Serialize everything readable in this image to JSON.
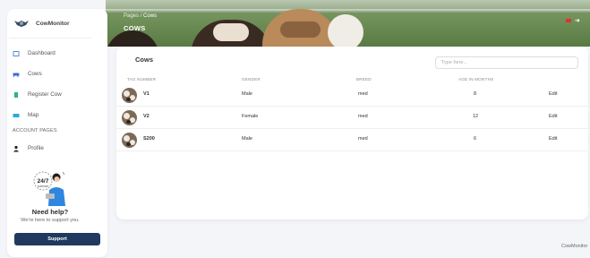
{
  "header": {
    "breadcrumb_root": "Pages",
    "breadcrumb_sep": "/",
    "breadcrumb_current": "Cows",
    "page_title": "COWS"
  },
  "sidebar": {
    "brand": "CowMonitor",
    "items": [
      {
        "label": "Dashboard",
        "icon": "dashboard-icon"
      },
      {
        "label": "Cows",
        "icon": "cow-icon"
      },
      {
        "label": "Register Cow",
        "icon": "register-icon"
      },
      {
        "label": "Map",
        "icon": "map-icon"
      }
    ],
    "section_label": "ACCOUNT PAGES",
    "profile_label": "Profile",
    "support": {
      "badge": "24/7",
      "badge_sub": "SUPPORT",
      "title": "Need help?",
      "subtitle": "We're here to support you.",
      "button": "Support"
    }
  },
  "card": {
    "title": "Cows",
    "search_placeholder": "Type here...",
    "columns": [
      "TAG NUMBER",
      "GENDER",
      "BREED",
      "AGE IN MONTHS",
      ""
    ],
    "rows": [
      {
        "tag": "V1",
        "gender": "Male",
        "breed": "med",
        "age": "8",
        "action": "Edit"
      },
      {
        "tag": "V2",
        "gender": "Female",
        "breed": "med",
        "age": "12",
        "action": "Edit"
      },
      {
        "tag": "S200",
        "gender": "Male",
        "breed": "med",
        "age": "6",
        "action": "Edit"
      }
    ]
  },
  "footer": {
    "text": "CowMonitor"
  },
  "colors": {
    "primary": "#1f3a5e",
    "accent_red": "#e03030",
    "background": "#f4f5f8"
  }
}
